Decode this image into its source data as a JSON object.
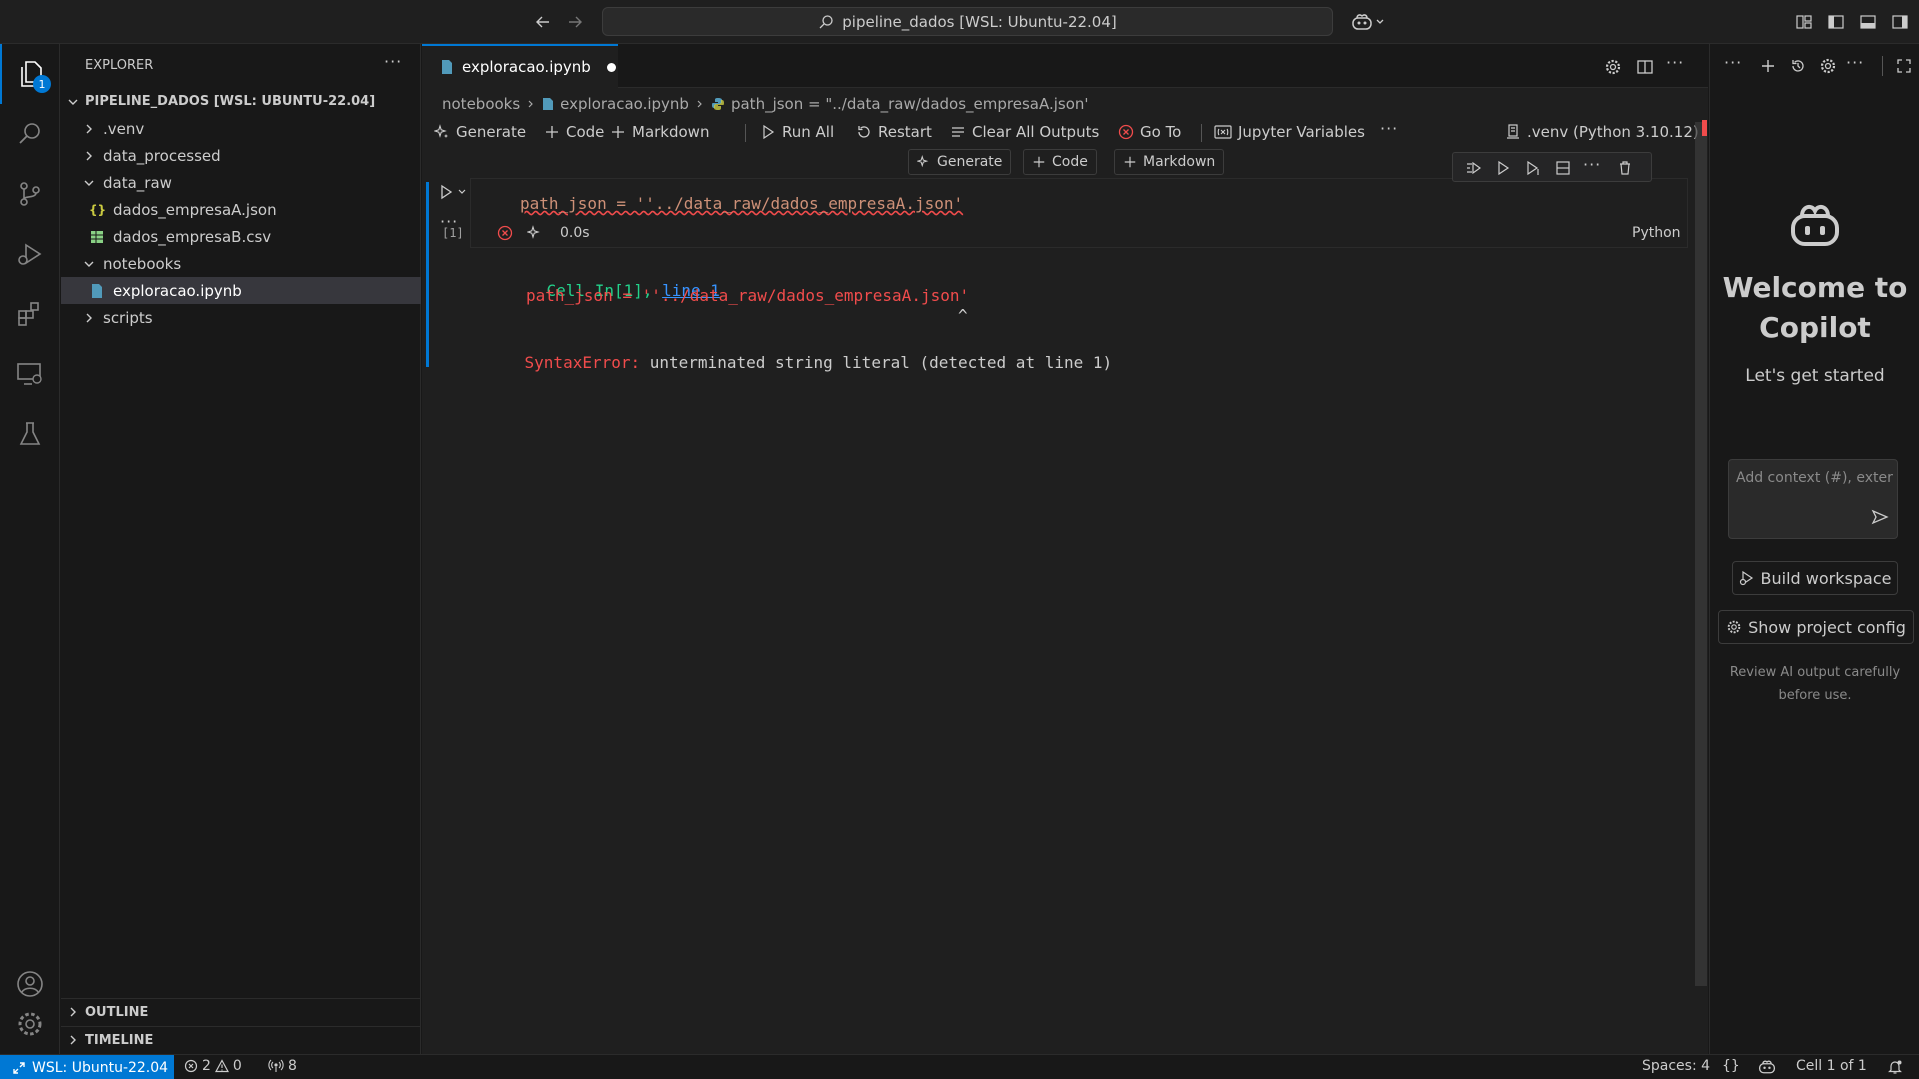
{
  "window": {
    "search_title": "pipeline_dados [WSL: Ubuntu-22.04]"
  },
  "activity": {
    "explorer_badge": "1"
  },
  "explorer": {
    "title": "EXPLORER",
    "root": "PIPELINE_DADOS [WSL: UBUNTU-22.04]",
    "items": [
      {
        "label": ".venv"
      },
      {
        "label": "data_processed"
      },
      {
        "label": "data_raw"
      },
      {
        "label": "dados_empresaA.json"
      },
      {
        "label": "dados_empresaB.csv"
      },
      {
        "label": "notebooks"
      },
      {
        "label": "exploracao.ipynb"
      },
      {
        "label": "scripts"
      }
    ],
    "json_glyph": "{}",
    "outline": "OUTLINE",
    "timeline": "TIMELINE"
  },
  "tab": {
    "filename": "exploracao.ipynb"
  },
  "breadcrumb": {
    "folder": "notebooks",
    "file": "exploracao.ipynb",
    "symbol": "path_json = \"../data_raw/dados_empresaA.json'"
  },
  "toolbar": {
    "generate": "Generate",
    "code": "Code",
    "markdown": "Markdown",
    "run_all": "Run All",
    "restart": "Restart",
    "clear_outputs": "Clear All Outputs",
    "go_to": "Go To",
    "jupyter_variables": "Jupyter Variables",
    "kernel": ".venv (Python 3.10.12)"
  },
  "cell": {
    "code": "path_json = ''../data_raw/dados_empresaA.json'",
    "exec_count": "[1]",
    "duration": "0.0s",
    "language": "Python",
    "output": {
      "cell_ref_prefix": "Cell In[1], ",
      "cell_ref_link": "line 1",
      "code_line": "path_json = ''../data_raw/dados_empresaA.json'",
      "caret": "^",
      "error_type": "SyntaxError:",
      "error_msg": " unterminated string literal (detected at line 1)"
    }
  },
  "copilot": {
    "welcome": "Welcome to Copilot",
    "subtitle": "Let's get started",
    "input_placeholder": "Add context (#), exter",
    "build_workspace": "Build workspace",
    "show_project_config": "Show project config",
    "disclaimer": "Review AI output carefully before use."
  },
  "status": {
    "remote": "WSL: Ubuntu-22.04",
    "errors": "2",
    "warnings": "0",
    "ports": "8",
    "spaces": "Spaces: 4",
    "braces": "{}",
    "cell_pos": "Cell 1 of 1"
  },
  "colors": {
    "accent": "#0078d4",
    "error": "#f14c4c",
    "string": "#ce9178",
    "link": "#3794ff"
  }
}
